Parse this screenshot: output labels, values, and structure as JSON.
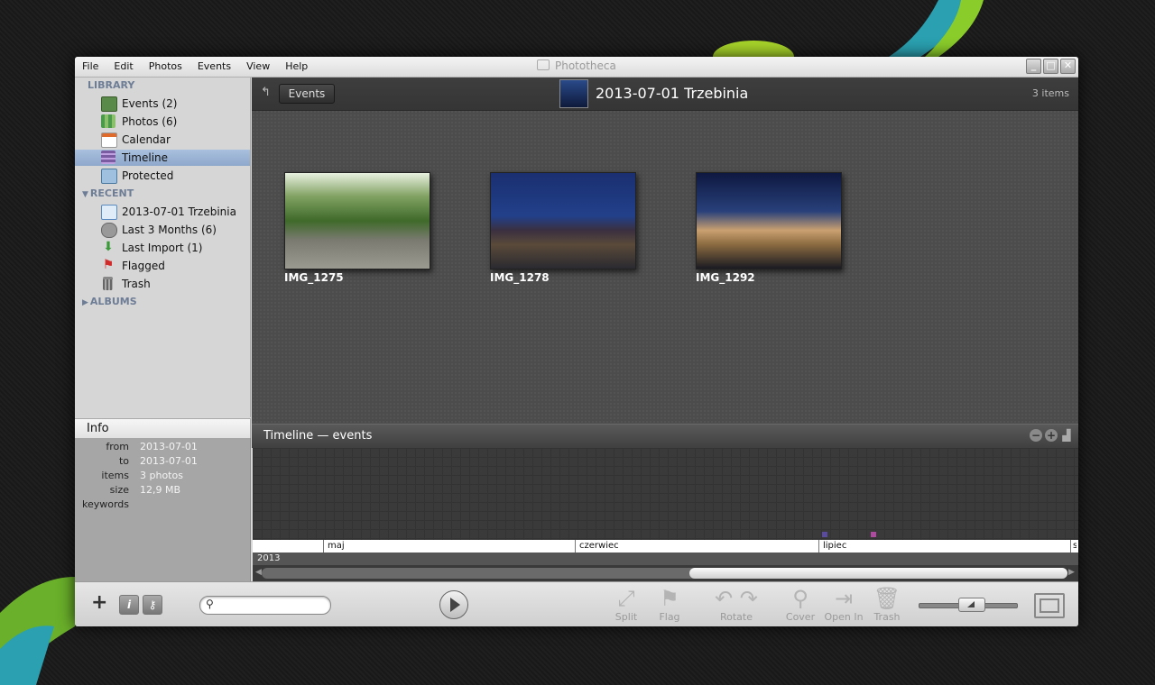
{
  "window": {
    "title": "Phototheca"
  },
  "menu": [
    "File",
    "Edit",
    "Photos",
    "Events",
    "View",
    "Help"
  ],
  "sidebar": {
    "library_header": "LIBRARY",
    "library": [
      {
        "label": "Events (2)",
        "icon": "events-icon",
        "color": "#5a8a4a"
      },
      {
        "label": "Photos (6)",
        "icon": "photos-icon",
        "color": "#4a9a4a"
      },
      {
        "label": "Calendar",
        "icon": "calendar-icon",
        "color": "#e06a2a"
      },
      {
        "label": "Timeline",
        "icon": "timeline-icon",
        "color": "#7a5aa0",
        "selected": true
      },
      {
        "label": "Protected",
        "icon": "protected-icon",
        "color": "#4a7aa0"
      }
    ],
    "recent_header": "RECENT",
    "recent": [
      {
        "label": "2013-07-01 Trzebinia",
        "icon": "event-edit-icon",
        "color": "#5a8ac0"
      },
      {
        "label": "Last 3 Months (6)",
        "icon": "clock-icon",
        "color": "#777"
      },
      {
        "label": "Last Import (1)",
        "icon": "import-icon",
        "color": "#3a9a3a"
      },
      {
        "label": "Flagged",
        "icon": "flag-icon",
        "color": "#d02a2a"
      },
      {
        "label": "Trash",
        "icon": "trash-icon",
        "color": "#777"
      }
    ],
    "albums_header": "ALBUMS"
  },
  "info": {
    "header": "Info",
    "rows": [
      {
        "key": "from",
        "value": "2013-07-01"
      },
      {
        "key": "to",
        "value": "2013-07-01"
      },
      {
        "key": "items",
        "value": "3 photos"
      },
      {
        "key": "size",
        "value": "12,9 MB"
      },
      {
        "key": "keywords",
        "value": ""
      }
    ]
  },
  "main": {
    "back_button": "Events",
    "event_title": "2013-07-01 Trzebinia",
    "count": "3 items",
    "photos": [
      {
        "name": "IMG_1275"
      },
      {
        "name": "IMG_1278"
      },
      {
        "name": "IMG_1292"
      }
    ]
  },
  "timeline": {
    "title": "Timeline — events",
    "months": [
      "maj",
      "czerwiec",
      "lipiec",
      "s"
    ],
    "year": "2013",
    "marker_colors": [
      "#5a4aa0",
      "#b04aa0"
    ]
  },
  "toolbar": {
    "search_placeholder": "",
    "actions": [
      {
        "label": "Split",
        "icon": "split-icon"
      },
      {
        "label": "Flag",
        "icon": "flag-icon"
      },
      {
        "label": "Rotate",
        "icon": "rotate-icon"
      },
      {
        "label": "Cover",
        "icon": "pin-icon"
      },
      {
        "label": "Open In",
        "icon": "open-in-icon"
      },
      {
        "label": "Trash",
        "icon": "trash-icon"
      }
    ],
    "zoom_level": 0.55
  }
}
